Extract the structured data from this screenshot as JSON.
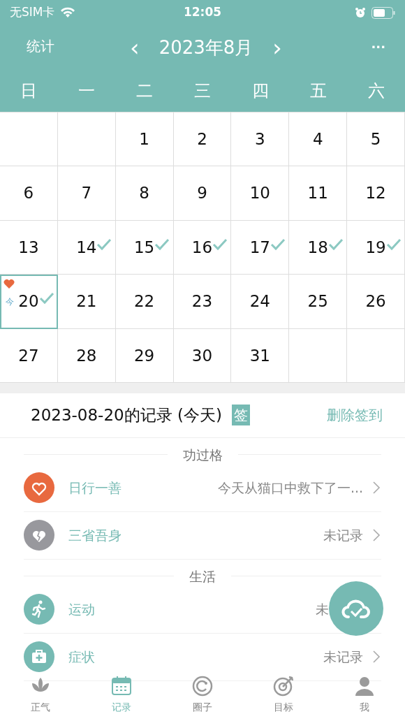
{
  "status_bar": {
    "carrier": "无SIM卡",
    "time": "12:05"
  },
  "header": {
    "left": "统计",
    "prev": "‹",
    "title": "2023年8月",
    "next": "›",
    "more": "···"
  },
  "weekdays": [
    "日",
    "一",
    "二",
    "三",
    "四",
    "五",
    "六"
  ],
  "weeks": [
    [
      {
        "kind": "empty"
      },
      {
        "kind": "empty"
      },
      {
        "kind": "day",
        "day": "1",
        "checked": false
      },
      {
        "kind": "day",
        "day": "2",
        "checked": false
      },
      {
        "kind": "day",
        "day": "3",
        "checked": false
      },
      {
        "kind": "day",
        "day": "4",
        "checked": false
      },
      {
        "kind": "day",
        "day": "5",
        "checked": false
      }
    ],
    [
      {
        "kind": "day",
        "day": "6",
        "checked": false
      },
      {
        "kind": "day",
        "day": "7",
        "checked": false
      },
      {
        "kind": "day",
        "day": "8",
        "checked": false
      },
      {
        "kind": "day",
        "day": "9",
        "checked": false
      },
      {
        "kind": "day",
        "day": "10",
        "checked": false
      },
      {
        "kind": "day",
        "day": "11",
        "checked": false
      },
      {
        "kind": "day",
        "day": "12",
        "checked": false
      }
    ],
    [
      {
        "kind": "day",
        "day": "13",
        "checked": false
      },
      {
        "kind": "day",
        "day": "14",
        "checked": true
      },
      {
        "kind": "day",
        "day": "15",
        "checked": true
      },
      {
        "kind": "day",
        "day": "16",
        "checked": true
      },
      {
        "kind": "day",
        "day": "17",
        "checked": true
      },
      {
        "kind": "day",
        "day": "18",
        "checked": true
      },
      {
        "kind": "day",
        "day": "19",
        "checked": true
      }
    ],
    [
      {
        "kind": "day",
        "day": "20",
        "checked": true,
        "selected": true,
        "today_mark": "今",
        "heart": true
      },
      {
        "kind": "day",
        "day": "21",
        "checked": false
      },
      {
        "kind": "day",
        "day": "22",
        "checked": false
      },
      {
        "kind": "day",
        "day": "23",
        "checked": false
      },
      {
        "kind": "day",
        "day": "24",
        "checked": false
      },
      {
        "kind": "day",
        "day": "25",
        "checked": false
      },
      {
        "kind": "day",
        "day": "26",
        "checked": false
      }
    ],
    [
      {
        "kind": "day",
        "day": "27",
        "checked": false
      },
      {
        "kind": "day",
        "day": "28",
        "checked": false
      },
      {
        "kind": "day",
        "day": "29",
        "checked": false
      },
      {
        "kind": "day",
        "day": "30",
        "checked": false
      },
      {
        "kind": "day",
        "day": "31",
        "checked": false
      },
      {
        "kind": "empty"
      },
      {
        "kind": "empty"
      }
    ]
  ],
  "record": {
    "title": "2023-08-20的记录 (今天)",
    "badge": "签",
    "action": "删除签到"
  },
  "sections": [
    {
      "title": "功过格",
      "items": [
        {
          "label": "日行一善",
          "value": "今天从猫口中救下了一...",
          "color": "#e8693f",
          "chevron": true
        },
        {
          "label": "三省吾身",
          "value": "未记录",
          "color": "#98989d",
          "chevron": true
        }
      ]
    },
    {
      "title": "生活",
      "items": [
        {
          "label": "运动",
          "value": "未",
          "color": "#76bab3",
          "chevron": false
        },
        {
          "label": "症状",
          "value": "未记录",
          "color": "#76bab3",
          "chevron": true
        }
      ]
    }
  ],
  "tabs": [
    {
      "label": "正气",
      "selected": false
    },
    {
      "label": "记录",
      "selected": true
    },
    {
      "label": "圈子",
      "selected": false
    },
    {
      "label": "目标",
      "selected": false
    },
    {
      "label": "我",
      "selected": false
    }
  ]
}
